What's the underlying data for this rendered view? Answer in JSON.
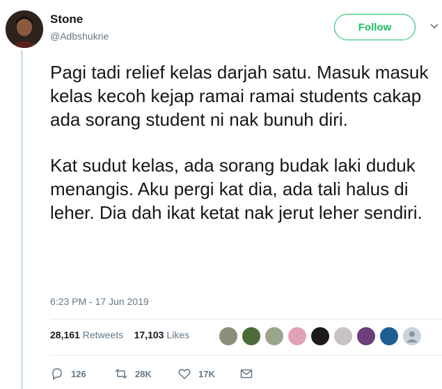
{
  "author": {
    "name": "Stone",
    "handle": "@Adbshukrie"
  },
  "follow_button": {
    "label": "Follow"
  },
  "tweet": {
    "paragraphs": [
      "Pagi tadi relief kelas darjah satu. Masuk masuk kelas kecoh kejap ramai ramai students cakap ada sorang student ni nak bunuh diri.",
      "Kat sudut kelas, ada sorang budak laki duduk menangis. Aku pergi kat dia, ada tali halus di leher. Dia dah ikat ketat nak jerut leher sendiri."
    ],
    "timestamp": "6:23 PM - 17 Jun 2019"
  },
  "stats": {
    "retweets_count": "28,161",
    "retweets_label": "Retweets",
    "likes_count": "17,103",
    "likes_label": "Likes",
    "liker_avatar_count": 9
  },
  "actions": {
    "reply_count": "126",
    "retweet_count": "28K",
    "like_count": "17K"
  },
  "colors": {
    "follow_accent": "#17bf63",
    "muted_text": "#657786",
    "thread_line": "#cfe8d2"
  }
}
